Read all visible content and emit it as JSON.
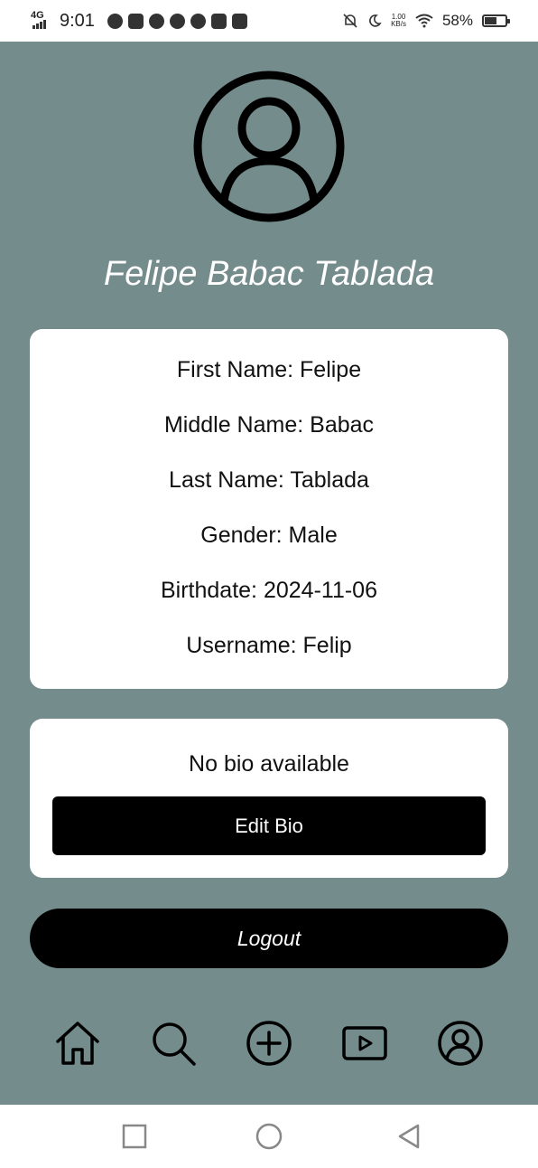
{
  "status_bar": {
    "network": "4G",
    "time": "9:01",
    "net_speed_value": "1.00",
    "net_speed_unit": "KB/s",
    "battery_percent": "58%",
    "battery_level": 0.58
  },
  "profile": {
    "display_name": "Felipe Babac Tablada",
    "avatar_icon": "user-circle-icon"
  },
  "info": {
    "first_name_label": "First Name: ",
    "first_name": "Felipe",
    "middle_name_label": "Middle Name: ",
    "middle_name": "Babac",
    "last_name_label": "Last Name: ",
    "last_name": "Tablada",
    "gender_label": "Gender: ",
    "gender": "Male",
    "birthdate_label": "Birthdate: ",
    "birthdate": "2024-11-06",
    "username_label": "Username: ",
    "username": "Felip"
  },
  "bio": {
    "text": "No bio available",
    "edit_label": "Edit Bio"
  },
  "logout_label": "Logout",
  "tabs": [
    {
      "icon": "home-icon"
    },
    {
      "icon": "search-icon"
    },
    {
      "icon": "add-circle-icon"
    },
    {
      "icon": "video-play-icon"
    },
    {
      "icon": "profile-icon"
    }
  ],
  "colors": {
    "background": "#758c8d",
    "card": "#ffffff",
    "button": "#000000"
  }
}
